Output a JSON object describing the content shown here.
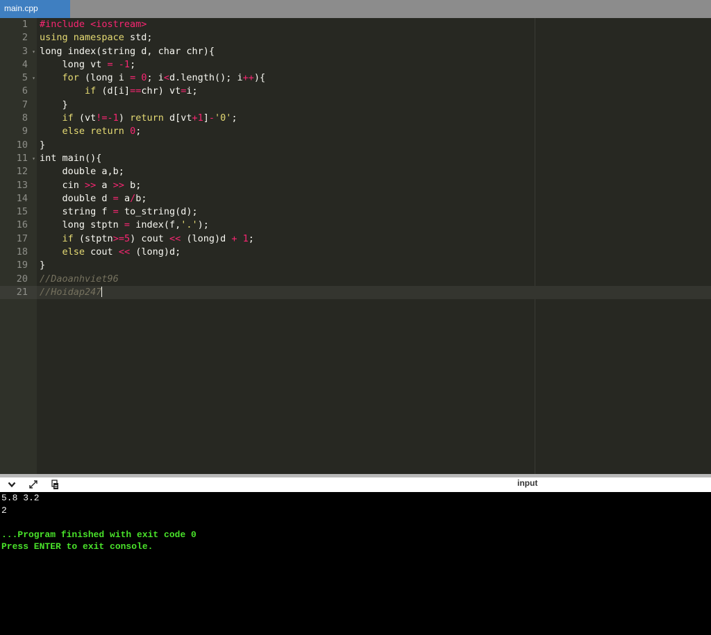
{
  "tab": {
    "title": "main.cpp"
  },
  "editor": {
    "lines": [
      {
        "n": "1",
        "fold": false,
        "tokens": [
          {
            "t": "#include <iostream>",
            "c": "k"
          }
        ]
      },
      {
        "n": "2",
        "fold": false,
        "tokens": [
          {
            "t": "using namespace ",
            "c": "kw"
          },
          {
            "t": "std;",
            "c": ""
          }
        ]
      },
      {
        "n": "3",
        "fold": true,
        "tokens": [
          {
            "t": "long index(string d, char chr){",
            "c": ""
          }
        ]
      },
      {
        "n": "4",
        "fold": false,
        "tokens": [
          {
            "t": "    long vt ",
            "c": ""
          },
          {
            "t": "= -1",
            "c": "k"
          },
          {
            "t": ";",
            "c": ""
          }
        ]
      },
      {
        "n": "5",
        "fold": true,
        "tokens": [
          {
            "t": "    ",
            "c": ""
          },
          {
            "t": "for",
            "c": "kw"
          },
          {
            "t": " (long i ",
            "c": ""
          },
          {
            "t": "= 0",
            "c": "k"
          },
          {
            "t": "; i",
            "c": ""
          },
          {
            "t": "<",
            "c": "k"
          },
          {
            "t": "d.length(); i",
            "c": ""
          },
          {
            "t": "++",
            "c": "k"
          },
          {
            "t": "){",
            "c": ""
          }
        ]
      },
      {
        "n": "6",
        "fold": false,
        "tokens": [
          {
            "t": "        ",
            "c": ""
          },
          {
            "t": "if",
            "c": "kw"
          },
          {
            "t": " (d[i]",
            "c": ""
          },
          {
            "t": "==",
            "c": "k"
          },
          {
            "t": "chr) vt",
            "c": ""
          },
          {
            "t": "=",
            "c": "k"
          },
          {
            "t": "i;",
            "c": ""
          }
        ]
      },
      {
        "n": "7",
        "fold": false,
        "tokens": [
          {
            "t": "    }",
            "c": ""
          }
        ]
      },
      {
        "n": "8",
        "fold": false,
        "tokens": [
          {
            "t": "    ",
            "c": ""
          },
          {
            "t": "if",
            "c": "kw"
          },
          {
            "t": " (vt",
            "c": ""
          },
          {
            "t": "!=-1",
            "c": "k"
          },
          {
            "t": ") ",
            "c": ""
          },
          {
            "t": "return",
            "c": "kw"
          },
          {
            "t": " d[vt",
            "c": ""
          },
          {
            "t": "+1",
            "c": "k"
          },
          {
            "t": "]",
            "c": ""
          },
          {
            "t": "-",
            "c": "k"
          },
          {
            "t": "'0'",
            "c": "kw"
          },
          {
            "t": ";",
            "c": ""
          }
        ]
      },
      {
        "n": "9",
        "fold": false,
        "tokens": [
          {
            "t": "    ",
            "c": ""
          },
          {
            "t": "else return",
            "c": "kw"
          },
          {
            "t": " ",
            "c": ""
          },
          {
            "t": "0",
            "c": "k"
          },
          {
            "t": ";",
            "c": ""
          }
        ]
      },
      {
        "n": "10",
        "fold": false,
        "tokens": [
          {
            "t": "}",
            "c": ""
          }
        ]
      },
      {
        "n": "11",
        "fold": true,
        "tokens": [
          {
            "t": "int main(){",
            "c": ""
          }
        ]
      },
      {
        "n": "12",
        "fold": false,
        "tokens": [
          {
            "t": "    double a,b;",
            "c": ""
          }
        ]
      },
      {
        "n": "13",
        "fold": false,
        "tokens": [
          {
            "t": "    cin ",
            "c": ""
          },
          {
            "t": ">>",
            "c": "k"
          },
          {
            "t": " a ",
            "c": ""
          },
          {
            "t": ">>",
            "c": "k"
          },
          {
            "t": " b;",
            "c": ""
          }
        ]
      },
      {
        "n": "14",
        "fold": false,
        "tokens": [
          {
            "t": "    double d ",
            "c": ""
          },
          {
            "t": "=",
            "c": "k"
          },
          {
            "t": " a",
            "c": ""
          },
          {
            "t": "/",
            "c": "k"
          },
          {
            "t": "b;",
            "c": ""
          }
        ]
      },
      {
        "n": "15",
        "fold": false,
        "tokens": [
          {
            "t": "    string f ",
            "c": ""
          },
          {
            "t": "=",
            "c": "k"
          },
          {
            "t": " to_string(d);",
            "c": ""
          }
        ]
      },
      {
        "n": "16",
        "fold": false,
        "tokens": [
          {
            "t": "    long stptn ",
            "c": ""
          },
          {
            "t": "=",
            "c": "k"
          },
          {
            "t": " index(f,",
            "c": ""
          },
          {
            "t": "'.'",
            "c": "kw"
          },
          {
            "t": ");",
            "c": ""
          }
        ]
      },
      {
        "n": "17",
        "fold": false,
        "tokens": [
          {
            "t": "    ",
            "c": ""
          },
          {
            "t": "if",
            "c": "kw"
          },
          {
            "t": " (stptn",
            "c": ""
          },
          {
            "t": ">=5",
            "c": "k"
          },
          {
            "t": ") cout ",
            "c": ""
          },
          {
            "t": "<<",
            "c": "k"
          },
          {
            "t": " (long)d ",
            "c": ""
          },
          {
            "t": "+ 1",
            "c": "k"
          },
          {
            "t": ";",
            "c": ""
          }
        ]
      },
      {
        "n": "18",
        "fold": false,
        "tokens": [
          {
            "t": "    ",
            "c": ""
          },
          {
            "t": "else",
            "c": "kw"
          },
          {
            "t": " cout ",
            "c": ""
          },
          {
            "t": "<<",
            "c": "k"
          },
          {
            "t": " (long)d;",
            "c": ""
          }
        ]
      },
      {
        "n": "19",
        "fold": false,
        "tokens": [
          {
            "t": "}",
            "c": ""
          }
        ]
      },
      {
        "n": "20",
        "fold": false,
        "tokens": [
          {
            "t": "//Daoanhviet96",
            "c": "c"
          }
        ]
      },
      {
        "n": "21",
        "fold": false,
        "active": true,
        "tokens": [
          {
            "t": "//Hoidap247",
            "c": "c"
          }
        ]
      }
    ]
  },
  "console": {
    "toolbar": {
      "collapse_icon": "chevron-down-icon",
      "expand_icon": "expand-icon",
      "copy_icon": "copy-icon",
      "input_label": "input"
    },
    "output": [
      "5.8 3.2",
      "2",
      "",
      "...Program finished with exit code 0",
      "Press ENTER to exit console."
    ],
    "green_from": 3
  },
  "colors": {
    "editor_bg": "#272822",
    "keyword": "#e6db74",
    "operator": "#f92672",
    "comment": "#75715e",
    "console_green": "#49e22a",
    "tab_active": "#3f7fc1"
  }
}
